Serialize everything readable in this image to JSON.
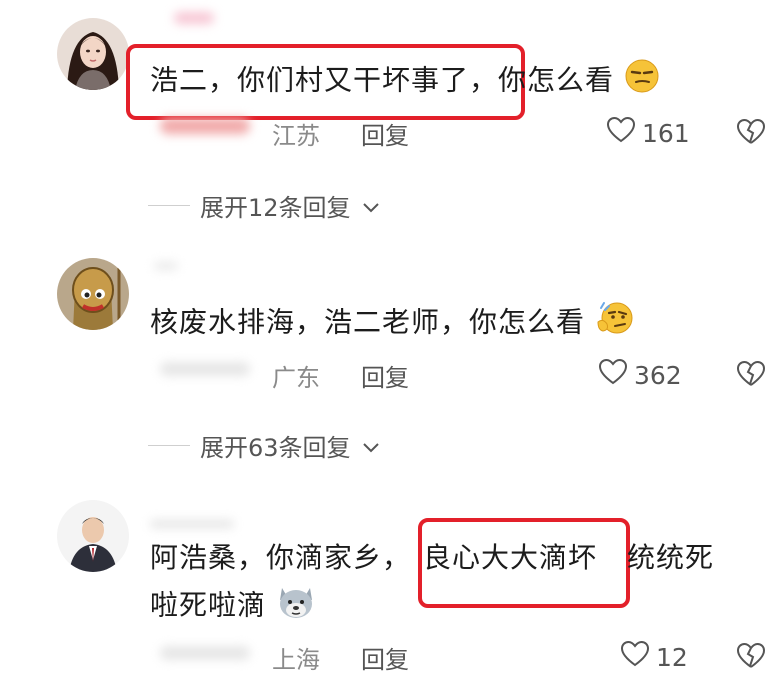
{
  "comments": [
    {
      "username": "",
      "text_highlighted": "浩二，你们村又干坏事了，",
      "text_rest": "你怎么看",
      "location": "江苏",
      "reply_label": "回复",
      "likes": "161",
      "expand_label": "展开12条回复",
      "emoji": "smirk-emoji"
    },
    {
      "username": "",
      "text": "核废水排海，浩二老师，你怎么看",
      "location": "广东",
      "reply_label": "回复",
      "likes": "362",
      "expand_label": "展开63条回复",
      "emoji": "thinking-emoji"
    },
    {
      "username": "",
      "text_before": "阿浩桑，你滴家乡，",
      "text_highlighted": "良心大大滴坏",
      "text_after": "统统死",
      "text_line2": "啦死啦滴",
      "location": "上海",
      "reply_label": "回复",
      "likes": "12",
      "emoji": "doge-emoji"
    }
  ],
  "colors": {
    "highlight_box": "#e3202a",
    "meta_text": "#8a8a8a",
    "body_text": "#1c1c1c"
  }
}
